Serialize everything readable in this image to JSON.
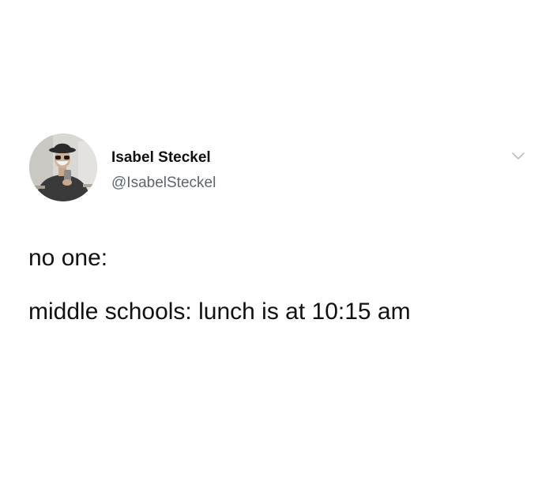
{
  "author": {
    "display_name": "Isabel Steckel",
    "handle": "@IsabelSteckel",
    "avatar_icon": "profile-photo-avatar"
  },
  "tweet": {
    "lines": [
      "no one:",
      "middle schools: lunch is at 10:15 am"
    ]
  },
  "menu": {
    "icon": "chevron-down-icon"
  },
  "colors": {
    "background": "#ffffff",
    "text": "#111111",
    "handle": "#5b6670",
    "chevron": "#b8bfc6"
  }
}
